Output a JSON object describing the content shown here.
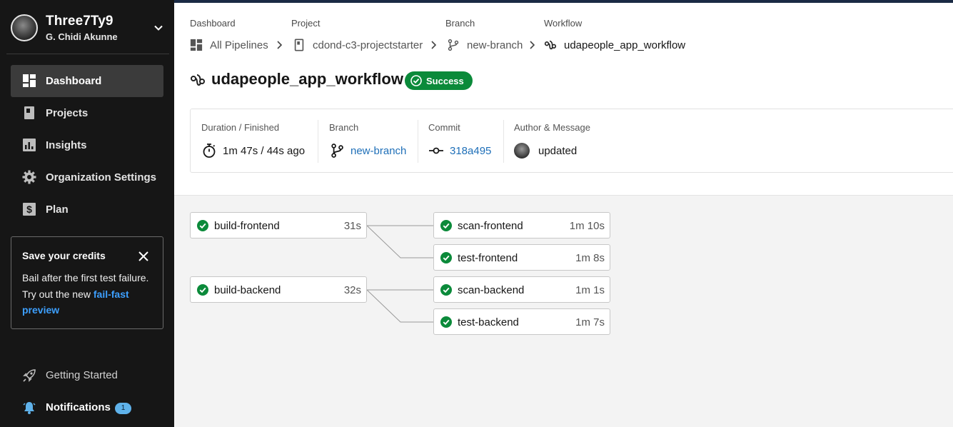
{
  "colors": {
    "sidebar_bg": "#161616",
    "success": "#0b8a3a",
    "link": "#1e6fb8",
    "accent_link": "#3da0ff",
    "badge": "#5fb2ea"
  },
  "sidebar": {
    "org_name": "Three7Ty9",
    "user_name": "G. Chidi Akunne",
    "nav": [
      {
        "label": "Dashboard",
        "icon": "dashboard-icon",
        "active": true
      },
      {
        "label": "Projects",
        "icon": "book-icon",
        "active": false
      },
      {
        "label": "Insights",
        "icon": "chart-icon",
        "active": false
      },
      {
        "label": "Organization Settings",
        "icon": "gear-icon",
        "active": false
      },
      {
        "label": "Plan",
        "icon": "dollar-icon",
        "active": false
      }
    ],
    "credits": {
      "title": "Save your credits",
      "body": "Bail after the first test failure. Try out the new",
      "link": "fail-fast preview"
    },
    "getting_started": "Getting Started",
    "notifications": {
      "label": "Notifications",
      "count": "1"
    }
  },
  "breadcrumb": {
    "dashboard": {
      "label": "Dashboard",
      "value": "All Pipelines"
    },
    "project": {
      "label": "Project",
      "value": "cdond-c3-projectstarter"
    },
    "branch": {
      "label": "Branch",
      "value": "new-branch"
    },
    "workflow": {
      "label": "Workflow",
      "value": "udapeople_app_workflow"
    }
  },
  "workflow": {
    "title": "udapeople_app_workflow",
    "status": "Success"
  },
  "meta": {
    "duration": {
      "label": "Duration / Finished",
      "value": "1m 47s / 44s ago"
    },
    "branch": {
      "label": "Branch",
      "value": "new-branch"
    },
    "commit": {
      "label": "Commit",
      "value": "318a495"
    },
    "author": {
      "label": "Author & Message",
      "value": "updated"
    }
  },
  "jobs": {
    "build_frontend": {
      "name": "build-frontend",
      "time": "31s"
    },
    "build_backend": {
      "name": "build-backend",
      "time": "32s"
    },
    "scan_frontend": {
      "name": "scan-frontend",
      "time": "1m 10s"
    },
    "test_frontend": {
      "name": "test-frontend",
      "time": "1m 8s"
    },
    "scan_backend": {
      "name": "scan-backend",
      "time": "1m 1s"
    },
    "test_backend": {
      "name": "test-backend",
      "time": "1m 7s"
    }
  }
}
